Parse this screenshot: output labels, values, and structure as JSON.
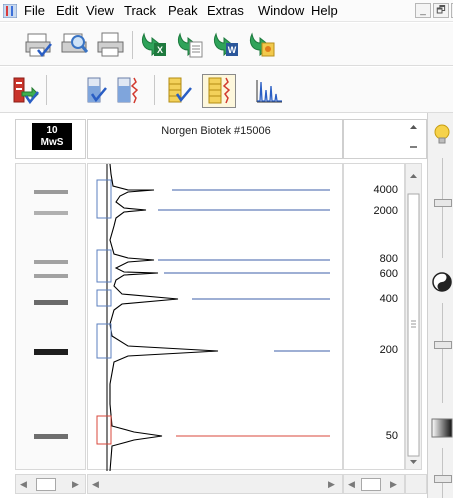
{
  "menu": {
    "items": [
      "File",
      "Edit",
      "View",
      "Track",
      "Peak",
      "Extras",
      "Window",
      "Help"
    ],
    "window_controls": [
      "_",
      "🗗",
      "x"
    ]
  },
  "toolbar1": {
    "icons": [
      "print-select-icon",
      "print-preview-icon",
      "print-icon",
      "export-excel-icon",
      "export-document-icon",
      "export-word-icon",
      "export-image-icon"
    ]
  },
  "toolbar2": {
    "icons": [
      "add-track-icon",
      "tube-select-icon",
      "tube-trace-icon",
      "ladder-select-icon",
      "ladder-trace-icon",
      "electropherogram-icon"
    ]
  },
  "marker": {
    "badge_top": "10",
    "badge_bottom": "MwS"
  },
  "trace": {
    "kit_name": "Norgen Biotek #15006"
  },
  "sizes": {
    "labels": [
      "4000",
      "2000",
      "800",
      "600",
      "400",
      "200",
      "50"
    ]
  },
  "colors": {
    "size_line": "#3c5fa8",
    "marker_line": "#d9473b",
    "bracket": "#5b7fbf",
    "marker_bracket": "#d9473b"
  }
}
